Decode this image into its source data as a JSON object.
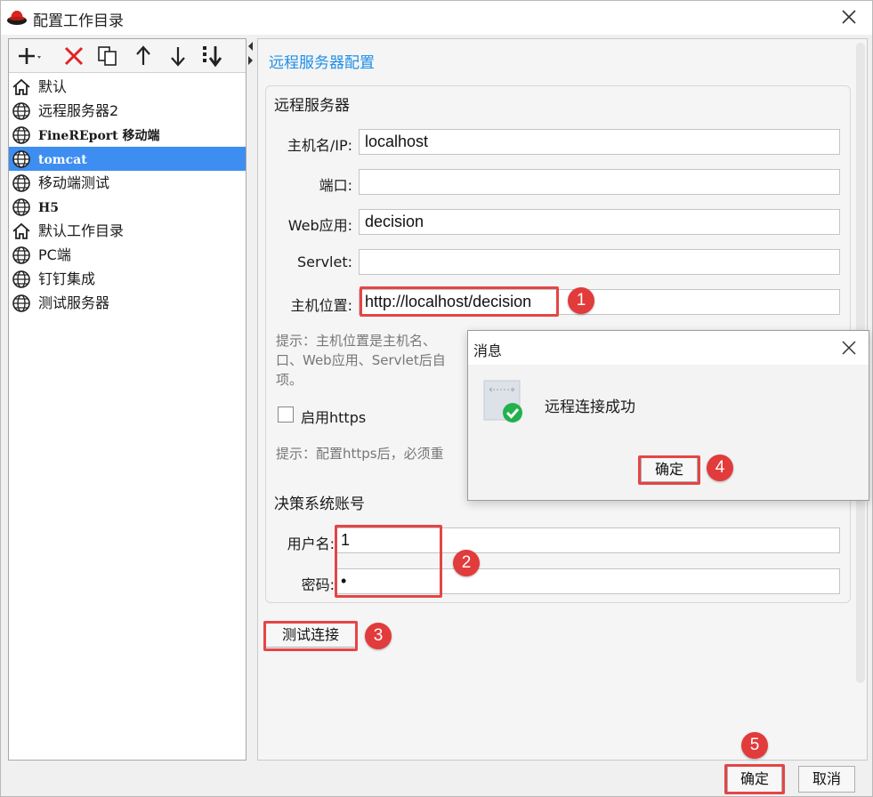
{
  "window": {
    "title": "配置工作目录"
  },
  "toolbar": {
    "buttons": [
      {
        "icon": "add-icon"
      },
      {
        "icon": "delete-icon"
      },
      {
        "icon": "copy-icon"
      },
      {
        "icon": "move-up-icon"
      },
      {
        "icon": "move-down-icon"
      },
      {
        "icon": "sort-icon"
      }
    ]
  },
  "tree": {
    "items": [
      {
        "label": "默认",
        "icon": "home-icon",
        "selected": false
      },
      {
        "label": "远程服务器2",
        "icon": "globe-icon",
        "selected": false
      },
      {
        "label": "FineREport 移动端",
        "icon": "globe-icon",
        "selected": false
      },
      {
        "label": "tomcat",
        "icon": "globe-icon",
        "selected": true
      },
      {
        "label": "移动端测试",
        "icon": "globe-icon",
        "selected": false
      },
      {
        "label": "H5",
        "icon": "globe-icon",
        "selected": false
      },
      {
        "label": "默认工作目录",
        "icon": "home-icon",
        "selected": false
      },
      {
        "label": "PC端",
        "icon": "globe-icon",
        "selected": false
      },
      {
        "label": "钉钉集成",
        "icon": "globe-icon",
        "selected": false
      },
      {
        "label": "测试服务器",
        "icon": "globe-icon",
        "selected": false
      }
    ]
  },
  "remote": {
    "section_title": "远程服务器配置",
    "group_title": "远程服务器",
    "hostname_label": "主机名/IP:",
    "hostname_value": "localhost",
    "port_label": "端口:",
    "port_value": "",
    "webapp_label": "Web应用:",
    "webapp_value": "decision",
    "servlet_label": "Servlet:",
    "servlet_value": "",
    "location_label": "主机位置:",
    "location_value": "http://localhost/decision",
    "hint_line1": "提示：主机位置是主机名、",
    "hint_line2": "口、Web应用、Servlet后自",
    "hint_line3": "项。",
    "https_label": "启用https",
    "https_checked": false,
    "https_hint": "提示：配置https后，必须重"
  },
  "account": {
    "group_title": "决策系统账号",
    "username_label": "用户名:",
    "username_value": "1",
    "password_label": "密码:",
    "password_value": "•"
  },
  "test_button_label": "测试连接",
  "dialog": {
    "title": "消息",
    "message": "远程连接成功",
    "ok_label": "确定"
  },
  "footer": {
    "ok_label": "确定",
    "cancel_label": "取消"
  },
  "annotations": {
    "badge1": "1",
    "badge2": "2",
    "badge3": "3",
    "badge4": "4",
    "badge5": "5"
  },
  "colors": {
    "accent": "#1e8ee8",
    "selection": "#3d8ef0",
    "annotation_red": "#e54545",
    "success_green": "#22b14c"
  }
}
